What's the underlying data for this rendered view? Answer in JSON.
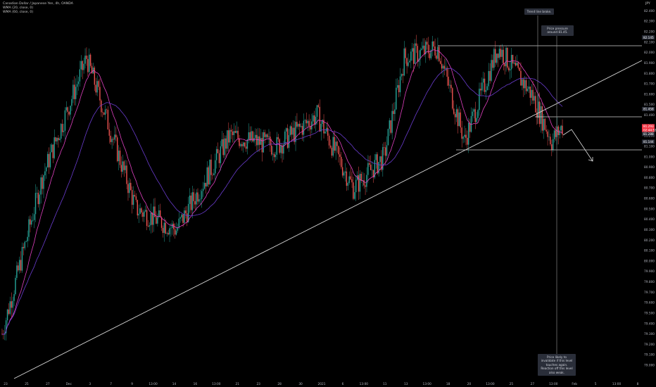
{
  "legend": {
    "symbol": "Canadian Dollar / Japanese Yen, 4h, OANDA",
    "ma1": "WMA (20, close, 0)",
    "ma2": "WMA (60, close, 0)"
  },
  "unit_label": "JPY",
  "annotations": {
    "trend_break": "Trend line broke.",
    "price_pressure": "Price pressure around 81.45.",
    "invalidate": "Price likely to invalidate if this level touches again. Reaction off this level also weak."
  },
  "price_axis": {
    "ticks": [
      "82.400",
      "82.300",
      "82.200",
      "82.100",
      "82.000",
      "81.900",
      "81.800",
      "81.700",
      "81.600",
      "81.500",
      "81.400",
      "81.300",
      "81.200",
      "81.100",
      "81.000",
      "80.900",
      "80.800",
      "80.700",
      "80.600",
      "80.500",
      "80.400",
      "80.300",
      "80.200",
      "80.100",
      "80.000",
      "79.900",
      "79.800",
      "79.700",
      "79.600",
      "79.500",
      "79.400",
      "79.300",
      "79.200",
      "79.100",
      "79.000"
    ],
    "tags": [
      {
        "label": "82.145",
        "color": "#2a2e39"
      },
      {
        "label": "81.458",
        "color": "#2a2e39"
      },
      {
        "label": "81.293",
        "color": "#f23645"
      },
      {
        "label": "02:44:51",
        "color": "#f23645"
      },
      {
        "label": "81.288",
        "color": "#2a2e39"
      },
      {
        "label": "81.144",
        "color": "#2a2e39"
      }
    ]
  },
  "time_axis": {
    "labels": [
      "23",
      "25",
      "27",
      "Dec",
      "3",
      "7",
      "9",
      "13:00",
      "14",
      "16",
      "13:00",
      "21",
      "23",
      "28",
      "30",
      "2021",
      "6",
      "13:00",
      "11",
      "13",
      "13:00",
      "18",
      "20",
      "13:00",
      "25",
      "27",
      "13:00",
      "Feb",
      "5",
      "13:00",
      "8"
    ]
  },
  "chart_data": {
    "type": "candlestick",
    "title": "Canadian Dollar / Japanese Yen, 4h, OANDA",
    "y_unit": "JPY",
    "ylim": [
      79.0,
      82.45
    ],
    "levels": [
      82.145,
      81.458,
      81.144
    ],
    "key_closes": [
      {
        "approx_index": 0,
        "price": 79.3
      },
      {
        "approx_index": 30,
        "price": 80.8
      },
      {
        "approx_index": 63,
        "price": 81.95
      },
      {
        "approx_index": 100,
        "price": 80.5
      },
      {
        "approx_index": 130,
        "price": 80.3
      },
      {
        "approx_index": 170,
        "price": 81.2
      },
      {
        "approx_index": 205,
        "price": 81.1
      },
      {
        "approx_index": 235,
        "price": 81.4
      },
      {
        "approx_index": 262,
        "price": 80.7
      },
      {
        "approx_index": 285,
        "price": 81.0
      },
      {
        "approx_index": 300,
        "price": 81.95
      },
      {
        "approx_index": 325,
        "price": 82.05
      },
      {
        "approx_index": 345,
        "price": 81.15
      },
      {
        "approx_index": 370,
        "price": 82.05
      },
      {
        "approx_index": 395,
        "price": 81.6
      },
      {
        "approx_index": 410,
        "price": 81.15
      },
      {
        "approx_index": 418,
        "price": 81.29
      }
    ],
    "colors": {
      "up": "#26a69a",
      "down": "#ef5350",
      "ma1": "#ff6ec7",
      "ma2": "#7e57c2"
    }
  }
}
